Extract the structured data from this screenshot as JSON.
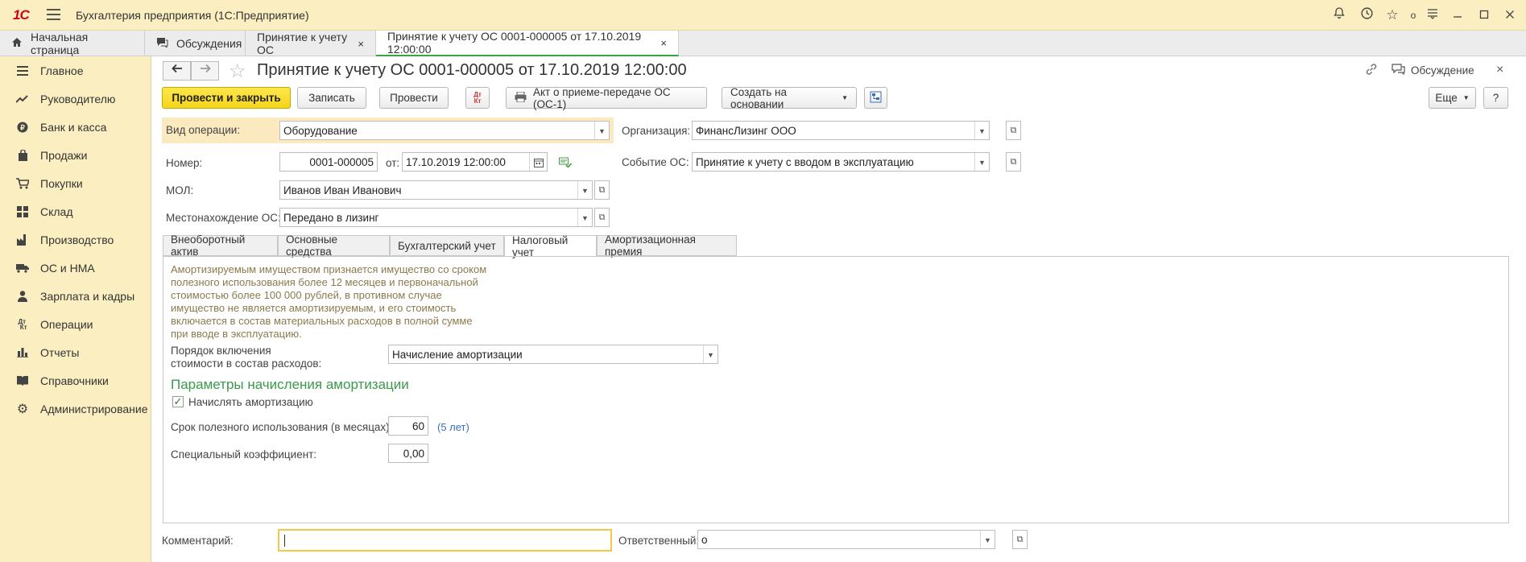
{
  "titlebar": {
    "logo": "1С",
    "app_title": "Бухгалтерия предприятия  (1С:Предприятие)",
    "icons": [
      "bell-icon",
      "history-icon",
      "star-icon",
      "dot-icon",
      "settings-icon",
      "minimize-icon",
      "maximize-icon",
      "close-icon"
    ],
    "dot": "o"
  },
  "tabs": [
    {
      "label": "Начальная страница",
      "icon": "home-icon"
    },
    {
      "label": "Обсуждения",
      "icon": "chat-icon"
    },
    {
      "label": "Принятие к учету ОС",
      "close": "×"
    },
    {
      "label": "Принятие к учету ОС 0001-000005 от 17.10.2019 12:00:00",
      "close": "×",
      "active": true
    }
  ],
  "sidebar": {
    "items": [
      {
        "label": "Главное",
        "icon": "menu-icon"
      },
      {
        "label": "Руководителю",
        "icon": "trend-icon"
      },
      {
        "label": "Банк и касса",
        "icon": "coin-icon"
      },
      {
        "label": "Продажи",
        "icon": "bag-icon"
      },
      {
        "label": "Покупки",
        "icon": "cart-icon"
      },
      {
        "label": "Склад",
        "icon": "warehouse-icon"
      },
      {
        "label": "Производство",
        "icon": "factory-icon"
      },
      {
        "label": "ОС и НМА",
        "icon": "truck-icon"
      },
      {
        "label": "Зарплата и кадры",
        "icon": "person-icon"
      },
      {
        "label": "Операции",
        "icon": "dtkt-icon"
      },
      {
        "label": "Отчеты",
        "icon": "barchart-icon"
      },
      {
        "label": "Справочники",
        "icon": "book-icon"
      },
      {
        "label": "Администрирование",
        "icon": "gear-icon"
      }
    ]
  },
  "form": {
    "title": "Принятие к учету ОС 0001-000005 от 17.10.2019 12:00:00",
    "discussion_label": "Обсуждение",
    "toolbar": {
      "post_close": "Провести и закрыть",
      "save": "Записать",
      "post": "Провести",
      "dtkt": "Дт Кт",
      "act": "Акт о приеме-передаче ОС (ОС-1)",
      "create_based": "Создать на основании",
      "more": "Еще",
      "help": "?"
    },
    "operation_type": {
      "label": "Вид операции:",
      "value": "Оборудование"
    },
    "number": {
      "label": "Номер:",
      "value": "0001-000005"
    },
    "date": {
      "label": "от:",
      "value": "17.10.2019 12:00:00"
    },
    "mol": {
      "label": "МОЛ:",
      "value": "Иванов Иван Иванович"
    },
    "location": {
      "label": "Местонахождение ОС:",
      "value": "Передано в лизинг"
    },
    "organization": {
      "label": "Организация:",
      "value": "ФинансЛизинг ООО"
    },
    "event": {
      "label": "Событие ОС:",
      "value": "Принятие к учету с вводом в эксплуатацию"
    },
    "tabs": [
      "Внеоборотный актив",
      "Основные средства",
      "Бухгалтерский учет",
      "Налоговый учет",
      "Амортизационная премия"
    ],
    "tax": {
      "note_lines": [
        "Амортизируемым имуществом признается имущество со сроком",
        "полезного использования более 12 месяцев и первоначальной",
        "стоимостью более 100 000 рублей, в противном случае",
        "имущество не является амортизируемым, и его стоимость",
        "включается в состав материальных расходов в полной сумме",
        "при вводе в эксплуатацию."
      ],
      "order_label_1": "Порядок включения",
      "order_label_2": "стоимости в состав расходов:",
      "order_value": "Начисление амортизации",
      "section_title": "Параметры начисления амортизации",
      "accrue_label": "Начислять амортизацию",
      "accrue_checked": "✓",
      "useful_life_label": "Срок полезного использования (в месяцах):",
      "useful_life_value": "60",
      "useful_life_hint": "(5 лет)",
      "coef_label": "Специальный коэффициент:",
      "coef_value": "0,00"
    },
    "comment": {
      "label": "Комментарий:",
      "value": ""
    },
    "responsible": {
      "label": "Ответственный:",
      "value": "о"
    }
  }
}
